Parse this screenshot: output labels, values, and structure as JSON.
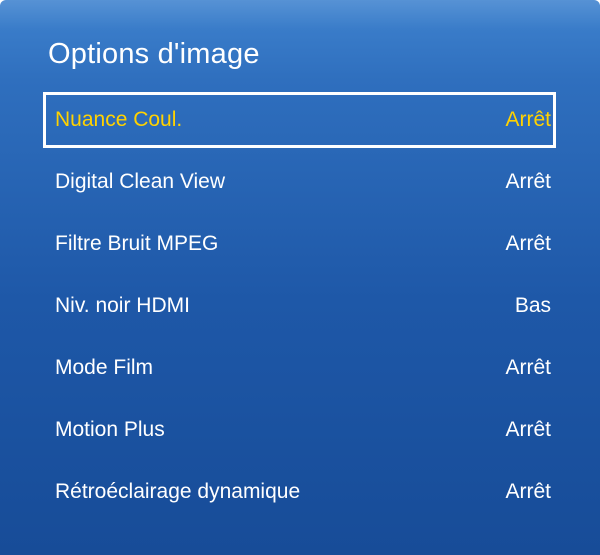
{
  "title": "Options d'image",
  "menu": {
    "items": [
      {
        "label": "Nuance Coul.",
        "value": "Arrêt",
        "selected": true
      },
      {
        "label": "Digital Clean View",
        "value": "Arrêt"
      },
      {
        "label": "Filtre Bruit MPEG",
        "value": "Arrêt"
      },
      {
        "label": "Niv. noir HDMI",
        "value": "Bas"
      },
      {
        "label": "Mode Film",
        "value": "Arrêt"
      },
      {
        "label": "Motion Plus",
        "value": "Arrêt"
      },
      {
        "label": "Rétroéclairage dynamique",
        "value": "Arrêt"
      }
    ]
  },
  "colors": {
    "background": "#1e58a8",
    "selected_text": "#ffd200",
    "text": "#ffffff",
    "selection_border": "#ffffff"
  }
}
